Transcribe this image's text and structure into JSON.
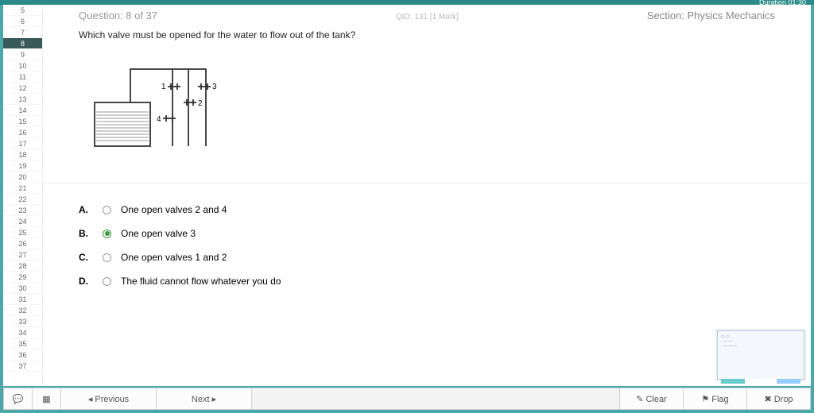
{
  "top_duration": "Duration 01:30",
  "qnav": {
    "start": 5,
    "end": 37,
    "current": 8
  },
  "header": {
    "qno": "Question: 8 of 37",
    "qid": "QID: 131  [1 Mark]",
    "section": "Section: Physics Mechanics"
  },
  "question": "Which valve must be opened for the water to flow out of the tank?",
  "diagram": {
    "labels": [
      "1",
      "2",
      "3",
      "4"
    ]
  },
  "options": [
    {
      "label": "A.",
      "text": "One open valves 2 and 4",
      "checked": false
    },
    {
      "label": "B.",
      "text": "One open valve 3",
      "checked": true
    },
    {
      "label": "C.",
      "text": "One open valves 1 and 2",
      "checked": false
    },
    {
      "label": "D.",
      "text": "The fluid cannot flow whatever you do",
      "checked": false
    }
  ],
  "footer": {
    "chat_icon": "💬",
    "grid_icon": "▦",
    "prev": "◂ Previous",
    "next": "Next ▸",
    "clear": "✎ Clear",
    "flag": "⚑ Flag",
    "drop": "✖ Drop"
  }
}
